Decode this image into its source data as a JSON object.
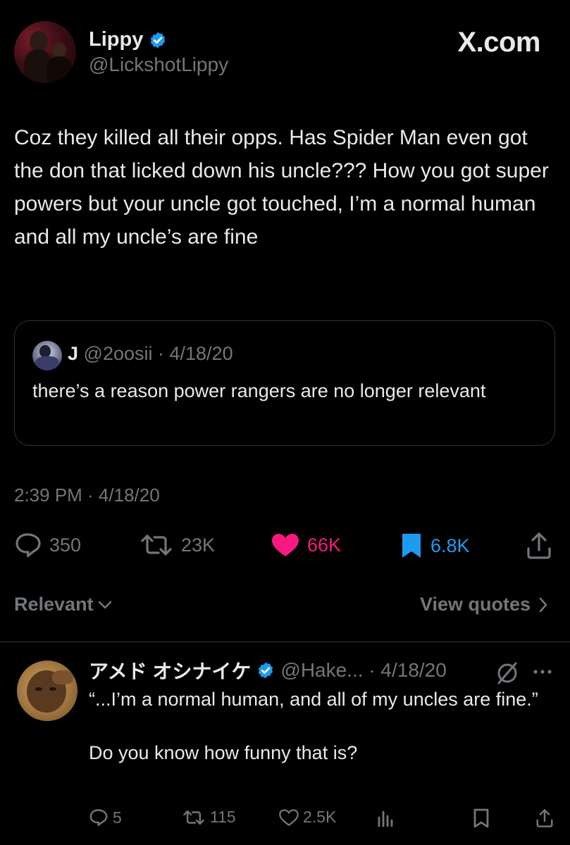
{
  "header": {
    "display_name": "Lippy",
    "handle": "@LickshotLippy",
    "site_logo": "X.com",
    "verified_color": "#1d9bf0"
  },
  "tweet": {
    "text": "Coz they killed all their opps. Has Spider Man even got the don that licked down his uncle??? How you got super powers but your uncle got touched, I’m a normal human and all my uncle’s are fine",
    "timestamp": "2:39 PM · 4/18/20"
  },
  "quote": {
    "name": "J",
    "meta": "@2oosii · 4/18/20",
    "text": "there’s a reason power rangers are no longer relevant"
  },
  "actions": {
    "replies": "350",
    "reposts": "23K",
    "likes": "66K",
    "bookmarks": "6.8K",
    "like_color": "#f91880",
    "bookmark_color": "#1d9bf0"
  },
  "sort": {
    "relevant_label": "Relevant",
    "view_quotes_label": "View quotes"
  },
  "reply": {
    "name": "アメド オシナイケ",
    "meta": "@Hake... · 4/18/20",
    "line1": "“...I’m a normal human, and all of my uncles are fine.”",
    "line2": "Do you know how funny that is?",
    "replies": "5",
    "reposts": "115",
    "likes": "2.5K"
  },
  "icons": [
    "verified-badge-icon",
    "reply-icon",
    "repost-icon",
    "like-icon",
    "bookmark-icon",
    "share-icon",
    "chevron-down-icon",
    "chevron-right-icon",
    "grok-icon",
    "more-icon",
    "views-icon"
  ]
}
